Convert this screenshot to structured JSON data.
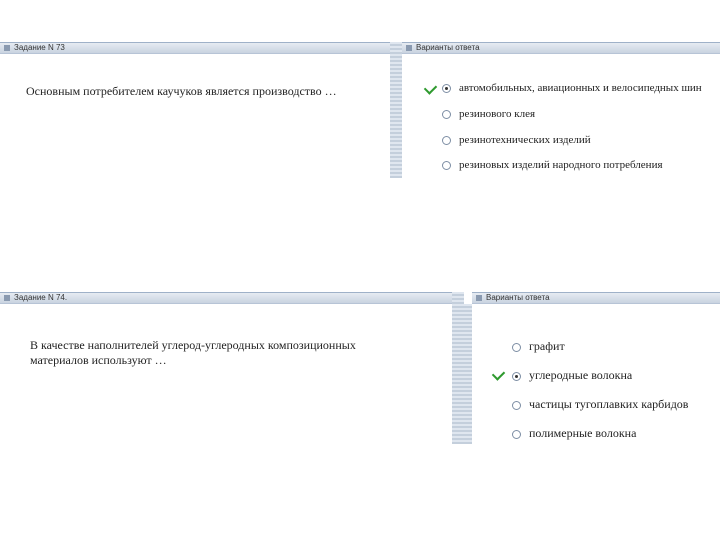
{
  "task1": {
    "header": "Задание N 73",
    "question": "Основным потребителем каучуков является производство …",
    "answers_header": "Варианты ответа",
    "options": [
      "автомобильных, авиационных и велосипедных шин",
      "резинового клея",
      "резинотехнических изделий",
      "резиновых изделий народного потребления"
    ],
    "selected_index": 0
  },
  "task2": {
    "header": "Задание N 74.",
    "question": "В качестве наполнителей углерод-углеродных композиционных материалов используют …",
    "answers_header": "Варианты ответа",
    "options": [
      "графит",
      "углеродные волокна",
      "частицы тугоплавких карбидов",
      "полимерные волокна"
    ],
    "selected_index": 1
  }
}
